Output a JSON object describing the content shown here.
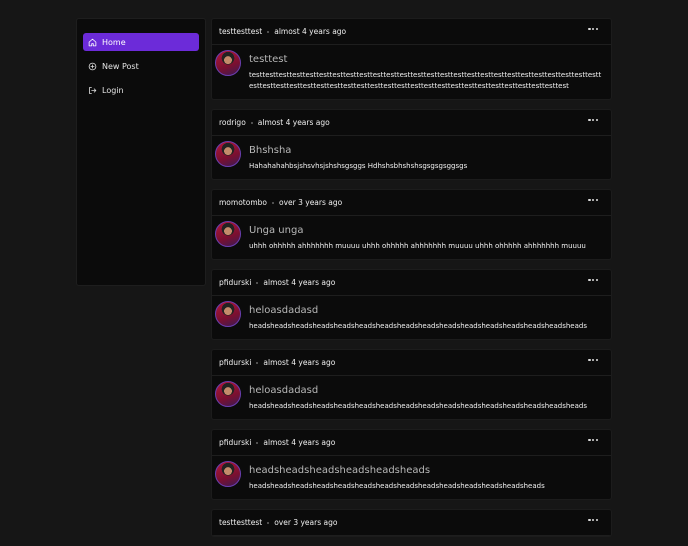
{
  "sidebar": {
    "items": [
      {
        "label": "Home",
        "icon": "home-icon",
        "active": true
      },
      {
        "label": "New Post",
        "icon": "plus-circle-icon",
        "active": false
      },
      {
        "label": "Login",
        "icon": "login-icon",
        "active": false
      }
    ]
  },
  "colors": {
    "accent": "#6c2bd9",
    "background": "#161616",
    "card": "#0b0b0b"
  },
  "posts": [
    {
      "author": "testtesttest",
      "time": "almost 4 years ago",
      "title": "testtest",
      "body": "testtesttesttesttesttesttesttesttesttesttesttesttesttesttesttesttesttesttesttesttesttesttesttesttesttesttesttesttesttesttesttesttesttesttesttesttesttesttesttesttesttesttesttesttesttesttesttesttesttest"
    },
    {
      "author": "rodrigo",
      "time": "almost 4 years ago",
      "title": "Bhshsha",
      "body": "Hahahahahbsjshsvhsjshshsgsggs Hdhshsbhshshsgsgsgsggsgs"
    },
    {
      "author": "momotombo",
      "time": "over 3 years ago",
      "title": "Unga unga",
      "body": "uhhh ohhhhh ahhhhhhh muuuu uhhh ohhhhh ahhhhhhh muuuu uhhh ohhhhh ahhhhhhh muuuu"
    },
    {
      "author": "pfidurski",
      "time": "almost 4 years ago",
      "title": "heloasdadasd",
      "body": "headsheadsheadsheadsheadsheadsheadsheadsheadsheadsheadsheadsheadsheadsheadsheads"
    },
    {
      "author": "pfidurski",
      "time": "almost 4 years ago",
      "title": "heloasdadasd",
      "body": "headsheadsheadsheadsheadsheadsheadsheadsheadsheadsheadsheadsheadsheadsheadsheads"
    },
    {
      "author": "pfidurski",
      "time": "almost 4 years ago",
      "title": "headsheadsheadsheadsheadsheads",
      "body": "headsheadsheadsheadsheadsheadsheadsheadsheadsheadsheadsheadsheadsheads"
    },
    {
      "author": "testtesttest",
      "time": "over 3 years ago",
      "title": "",
      "body": ""
    }
  ]
}
